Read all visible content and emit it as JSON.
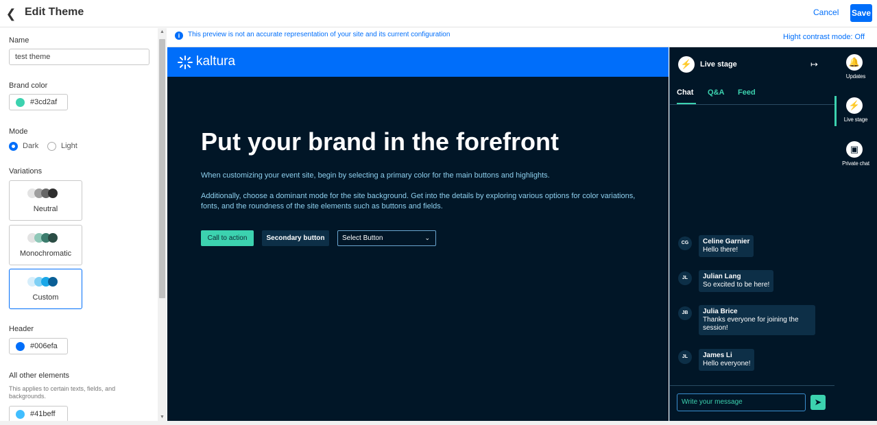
{
  "topbar": {
    "title": "Edit Theme",
    "cancel_label": "Cancel",
    "save_label": "Save"
  },
  "settings": {
    "name_label": "Name",
    "name_value": "test theme",
    "brand_color_label": "Brand color",
    "brand_color_value": "#3cd2af",
    "mode_label": "Mode",
    "mode_options": [
      "Dark",
      "Light"
    ],
    "mode_selected": "Dark",
    "variations_label": "Variations",
    "variations": [
      {
        "label": "Neutral",
        "colors": [
          "#e3e3e3",
          "#9e9e9e",
          "#666666",
          "#2e2e2e"
        ]
      },
      {
        "label": "Monochromatic",
        "colors": [
          "#e3e3e3",
          "#8fc8b8",
          "#3d7d6e",
          "#2b4d45"
        ]
      },
      {
        "label": "Custom",
        "colors": [
          "#d6eefb",
          "#7fd0f5",
          "#1aa7e8",
          "#0a5f96"
        ]
      }
    ],
    "variation_selected": "Custom",
    "header_label": "Header",
    "header_color_value": "#006efa",
    "other_label": "All other elements",
    "other_hint": "This applies to certain texts, fields, and backgrounds.",
    "other_color_value": "#41beff"
  },
  "notice": {
    "text": "This preview is not an accurate representation of your site and its current configuration",
    "contrast_label": "Hight contrast mode: Off"
  },
  "preview": {
    "logo_text": "kaltura",
    "headline": "Put your brand in the forefront",
    "paragraph1": "When customizing your event site, begin by selecting a primary color for the main buttons and highlights.",
    "paragraph2": "Additionally, choose a dominant mode for the site background. Get into the details by exploring various options for color variations, fonts, and the roundness of the site elements such as buttons and fields.",
    "cta_label": "Call to action",
    "secondary_label": "Secondary button",
    "select_label": "Select Button"
  },
  "live_stage": {
    "title": "Live stage",
    "tabs": [
      "Chat",
      "Q&A",
      "Feed"
    ],
    "active_tab": "Chat",
    "messages": [
      {
        "initials": "CG",
        "name": "Celine Garnier",
        "text": "Hello there!"
      },
      {
        "initials": "JL",
        "name": "Julian Lang",
        "text": "So excited to be here!"
      },
      {
        "initials": "JB",
        "name": "Julia Brice",
        "text": "Thanks everyone for joining the session!"
      },
      {
        "initials": "JL",
        "name": "James Li",
        "text": "Hello everyone!"
      }
    ],
    "compose_placeholder": "Write your message"
  },
  "rail": {
    "items": [
      {
        "label": "Updates",
        "icon": "bell-icon"
      },
      {
        "label": "Live stage",
        "icon": "lightning-icon"
      },
      {
        "label": "Private chat",
        "icon": "chat-icon"
      }
    ],
    "selected": "Live stage"
  },
  "colors": {
    "brand": "#3cd2af",
    "header": "#006efa",
    "other": "#41beff",
    "preview_bg": "#011627"
  }
}
